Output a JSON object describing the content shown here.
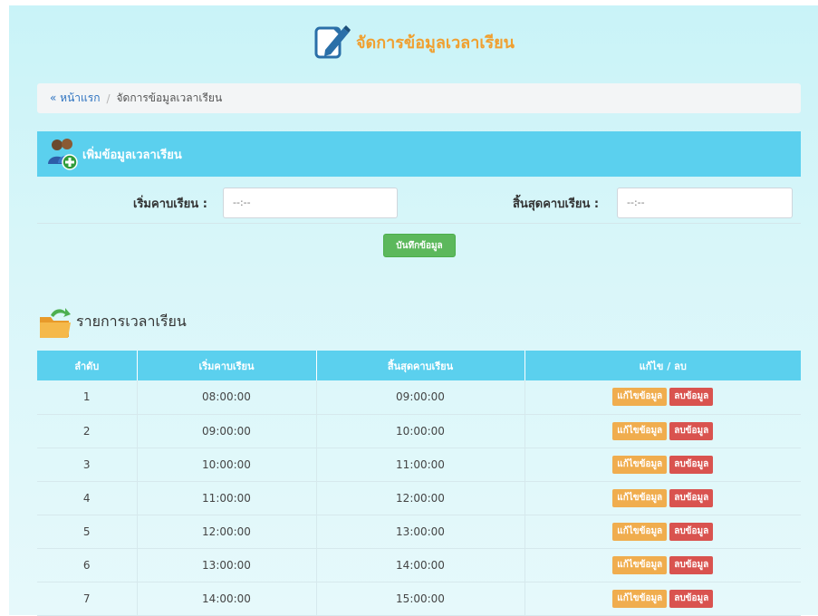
{
  "header": {
    "title": "จัดการข้อมูลเวลาเรียน",
    "icon": "edit-document-icon"
  },
  "breadcrumb": {
    "home": "« หน้าแรก",
    "separator": "/",
    "current": "จัดการข้อมูลเวลาเรียน"
  },
  "add_panel": {
    "title": "เพิ่มข้อมูลเวลาเรียน",
    "icon": "users-add-icon",
    "start_label": "เริ่มคาบเรียน :",
    "start_value": "--:--",
    "end_label": "สิ้นสุดคาบเรียน :",
    "end_value": "--:--",
    "save_label": "บันทึกข้อมูล"
  },
  "list": {
    "title": "รายการเวลาเรียน",
    "icon": "folder-icon",
    "columns": [
      "ลำดับ",
      "เริ่มคาบเรียน",
      "สิ้นสุดคาบเรียน",
      "แก้ไข / ลบ"
    ],
    "edit_label": "แก้ไขข้อมูล",
    "delete_label": "ลบข้อมูล",
    "rows": [
      {
        "no": "1",
        "start": "08:00:00",
        "end": "09:00:00"
      },
      {
        "no": "2",
        "start": "09:00:00",
        "end": "10:00:00"
      },
      {
        "no": "3",
        "start": "10:00:00",
        "end": "11:00:00"
      },
      {
        "no": "4",
        "start": "11:00:00",
        "end": "12:00:00"
      },
      {
        "no": "5",
        "start": "12:00:00",
        "end": "13:00:00"
      },
      {
        "no": "6",
        "start": "13:00:00",
        "end": "14:00:00"
      },
      {
        "no": "7",
        "start": "14:00:00",
        "end": "15:00:00"
      }
    ]
  },
  "colors": {
    "accent": "#5bd0ee",
    "title": "#f0a030",
    "save": "#5cb85c",
    "edit": "#f0ad4e",
    "delete": "#d9534f",
    "link": "#2e73c0"
  }
}
